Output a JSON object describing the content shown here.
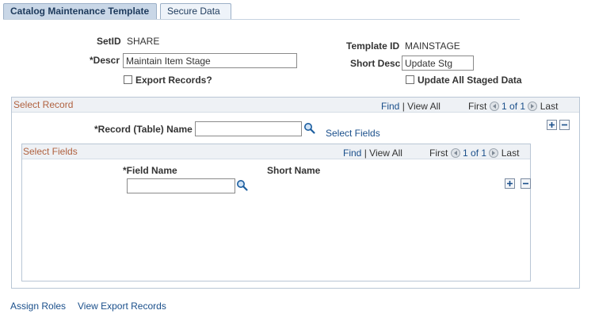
{
  "tabs": [
    {
      "label": "Catalog Maintenance Template",
      "active": true
    },
    {
      "label": "Secure Data",
      "active": false
    }
  ],
  "header": {
    "setid_label": "SetID",
    "setid_value": "SHARE",
    "descr_label": "*Descr",
    "descr_value": "Maintain Item Stage",
    "export_records_label": "Export Records?",
    "template_id_label": "Template ID",
    "template_id_value": "MAINSTAGE",
    "short_desc_label": "Short Desc",
    "short_desc_value": "Update Stg",
    "update_all_label": "Update All Staged Data"
  },
  "select_record": {
    "title": "Select Record",
    "find": "Find",
    "view_all": "View All",
    "first": "First",
    "count": "1 of 1",
    "last": "Last",
    "record_name_label": "*Record (Table) Name",
    "record_name_value": "",
    "select_fields_link": "Select Fields"
  },
  "select_fields": {
    "title": "Select Fields",
    "find": "Find",
    "view_all": "View All",
    "first": "First",
    "count": "1 of 1",
    "last": "Last",
    "field_name_label": "*Field Name",
    "short_name_label": "Short Name",
    "field_name_value": ""
  },
  "footer": {
    "assign_roles": "Assign Roles",
    "view_export_records": "View Export Records"
  },
  "colors": {
    "tab_active_bg": "#c9d7e7",
    "grid_title": "#b0613f",
    "link": "#1a4f8b"
  }
}
